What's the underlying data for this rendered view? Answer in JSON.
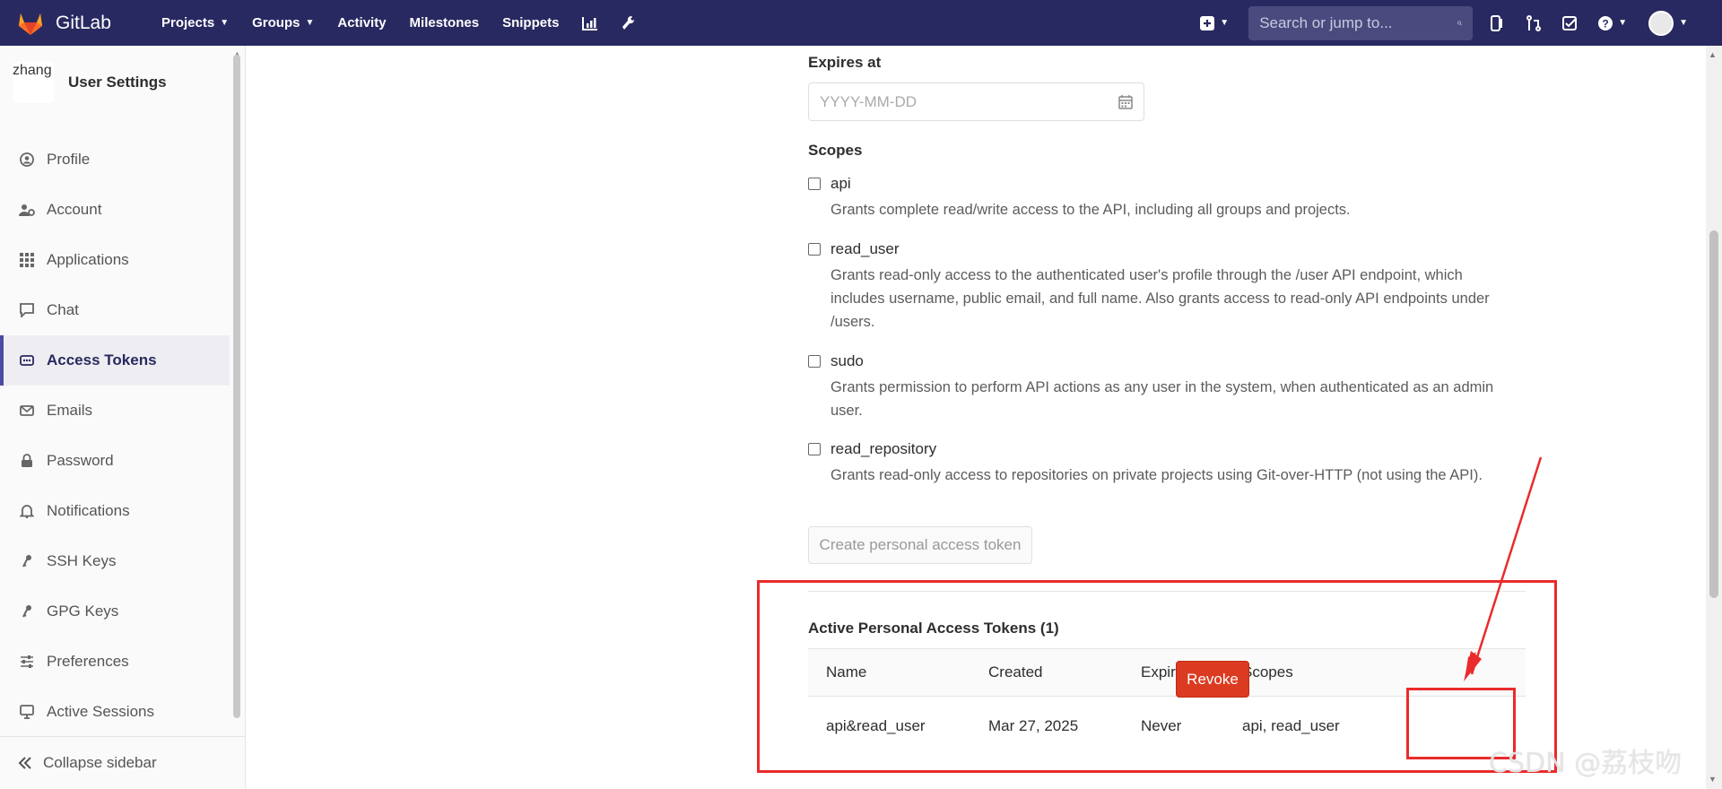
{
  "app": {
    "brand": "GitLab"
  },
  "topnav": {
    "links": [
      {
        "label": "Projects",
        "dropdown": true
      },
      {
        "label": "Groups",
        "dropdown": true
      },
      {
        "label": "Activity",
        "dropdown": false
      },
      {
        "label": "Milestones",
        "dropdown": false
      },
      {
        "label": "Snippets",
        "dropdown": false
      }
    ],
    "search_placeholder": "Search or jump to...",
    "bar_color": "#292961"
  },
  "sidebar": {
    "title": "User Settings",
    "avatar_alt": "zhang",
    "items": [
      {
        "label": "Profile",
        "icon": "profile-icon",
        "active": false
      },
      {
        "label": "Account",
        "icon": "account-icon",
        "active": false
      },
      {
        "label": "Applications",
        "icon": "applications-icon",
        "active": false
      },
      {
        "label": "Chat",
        "icon": "chat-icon",
        "active": false
      },
      {
        "label": "Access Tokens",
        "icon": "token-icon",
        "active": true
      },
      {
        "label": "Emails",
        "icon": "email-icon",
        "active": false
      },
      {
        "label": "Password",
        "icon": "lock-icon",
        "active": false
      },
      {
        "label": "Notifications",
        "icon": "bell-icon",
        "active": false
      },
      {
        "label": "SSH Keys",
        "icon": "key-icon",
        "active": false
      },
      {
        "label": "GPG Keys",
        "icon": "key-icon",
        "active": false
      },
      {
        "label": "Preferences",
        "icon": "sliders-icon",
        "active": false
      },
      {
        "label": "Active Sessions",
        "icon": "monitor-icon",
        "active": false
      }
    ],
    "collapse_label": "Collapse sidebar"
  },
  "form": {
    "expires_label": "Expires at",
    "expires_placeholder": "YYYY-MM-DD",
    "scopes_label": "Scopes",
    "scopes": [
      {
        "name": "api",
        "checked": false,
        "description": "Grants complete read/write access to the API, including all groups and projects."
      },
      {
        "name": "read_user",
        "checked": false,
        "description": "Grants read-only access to the authenticated user's profile through the /user API endpoint, which includes username, public email, and full name. Also grants access to read-only API endpoints under /users."
      },
      {
        "name": "sudo",
        "checked": false,
        "description": "Grants permission to perform API actions as any user in the system, when authenticated as an admin user."
      },
      {
        "name": "read_repository",
        "checked": false,
        "description": "Grants read-only access to repositories on private projects using Git-over-HTTP (not using the API)."
      }
    ],
    "create_button": "Create personal access token"
  },
  "tokens": {
    "title": "Active Personal Access Tokens (1)",
    "columns": [
      "Name",
      "Created",
      "Expires",
      "Scopes"
    ],
    "rows": [
      {
        "name": "api&read_user",
        "created": "Mar 27, 2025",
        "expires": "Never",
        "scopes": "api, read_user",
        "action": "Revoke"
      }
    ]
  },
  "annotation": {
    "color": "#ea2b2b"
  },
  "watermark": "CSDN @荔枝吻"
}
